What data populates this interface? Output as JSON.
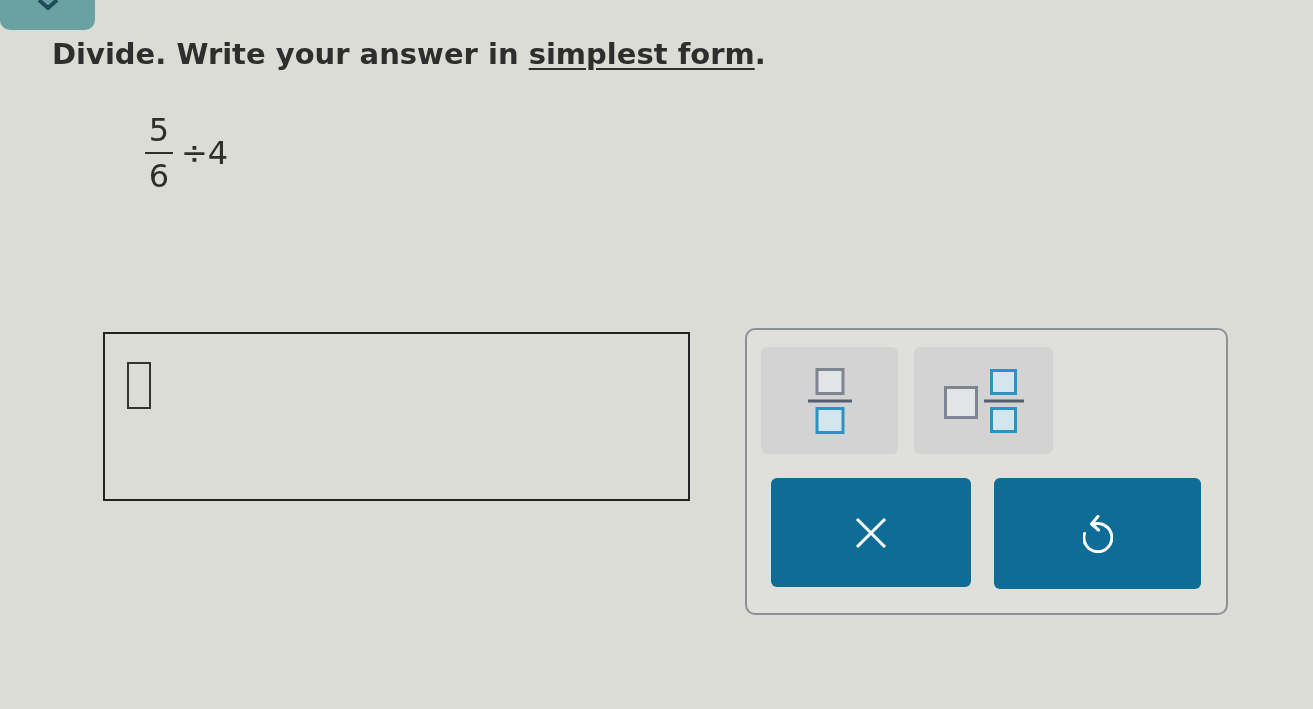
{
  "instruction": {
    "text": "Divide. Write your answer in",
    "link": "simplest form",
    "end": "."
  },
  "problem": {
    "numerator": "5",
    "denominator": "6",
    "operator": "÷",
    "divisor": "4"
  },
  "keypad": {
    "templates": [
      {
        "kind": "fraction"
      },
      {
        "kind": "mixed_number"
      }
    ],
    "actions": [
      {
        "kind": "clear"
      },
      {
        "kind": "undo"
      }
    ]
  }
}
